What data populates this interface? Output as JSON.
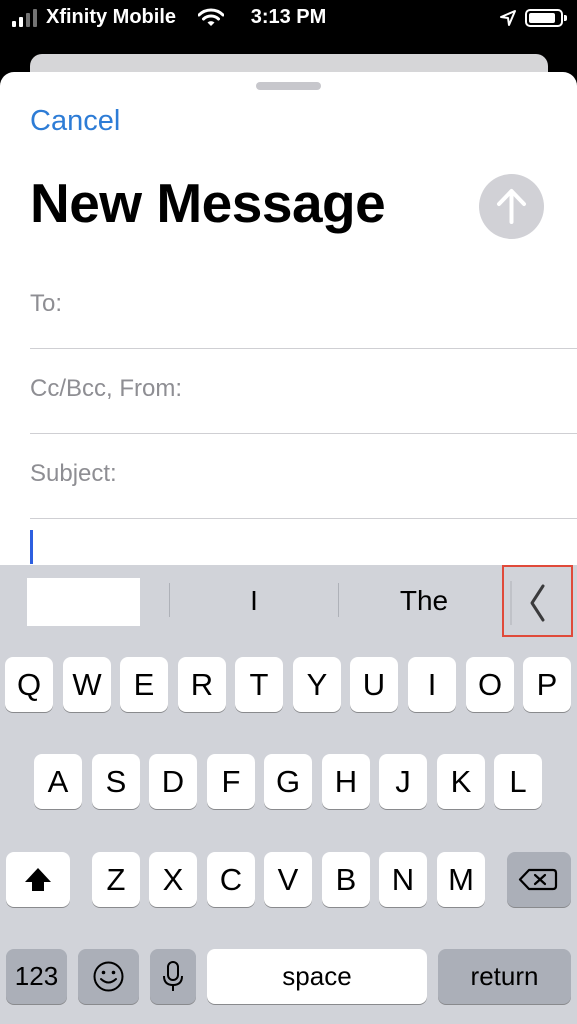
{
  "status_bar": {
    "carrier": "Xfinity Mobile",
    "time": "3:13 PM",
    "icons": [
      "signal-bars-icon",
      "wifi-icon",
      "location-arrow-icon",
      "battery-icon"
    ]
  },
  "compose": {
    "cancel_label": "Cancel",
    "title": "New Message",
    "send_icon": "arrow-up-icon",
    "fields": {
      "to_label": "To:",
      "cc_label": "Cc/Bcc, From:",
      "subject_label": "Subject:"
    }
  },
  "keyboard": {
    "suggestions": [
      "",
      "I",
      "The"
    ],
    "collapse_icon": "chevron-left-icon",
    "rows": {
      "row1": [
        "Q",
        "W",
        "E",
        "R",
        "T",
        "Y",
        "U",
        "I",
        "O",
        "P"
      ],
      "row2": [
        "A",
        "S",
        "D",
        "F",
        "G",
        "H",
        "J",
        "K",
        "L"
      ],
      "row3": [
        "Z",
        "X",
        "C",
        "V",
        "B",
        "N",
        "M"
      ]
    },
    "shift_icon": "shift-arrow-icon",
    "delete_icon": "backspace-icon",
    "numbers_label": "123",
    "emoji_icon": "emoji-icon",
    "mic_icon": "microphone-icon",
    "space_label": "space",
    "return_label": "return"
  },
  "colors": {
    "accent": "#2d7cd6",
    "highlight_border": "#e04a3a",
    "keyboard_bg": "#d1d3d9"
  }
}
